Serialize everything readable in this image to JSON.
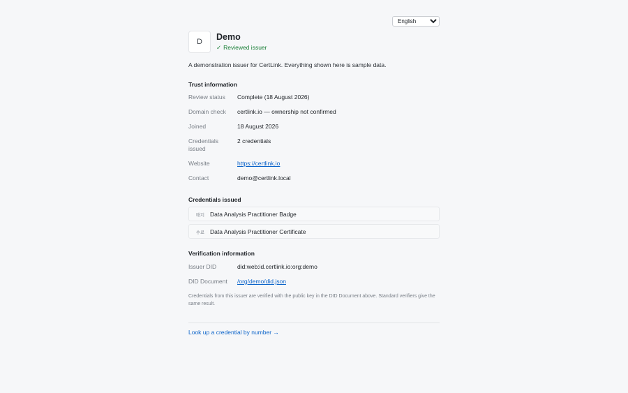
{
  "language": {
    "selected": "English",
    "options": [
      "English"
    ]
  },
  "issuer": {
    "avatar_letter": "D",
    "name": "Demo",
    "reviewed_check": "✓",
    "reviewed_label": "Reviewed issuer",
    "description": "A demonstration issuer for CertLink. Everything shown here is sample data."
  },
  "trust": {
    "title": "Trust information",
    "rows": [
      {
        "label": "Review status",
        "value": "Complete (18 August 2026)"
      },
      {
        "label": "Domain check",
        "value": "certlink.io — ownership not confirmed"
      },
      {
        "label": "Joined",
        "value": "18 August 2026"
      },
      {
        "label": "Credentials issued",
        "value": "2 credentials"
      },
      {
        "label": "Website",
        "value": "https://certlink.io"
      },
      {
        "label": "Contact",
        "value": "demo@certlink.local"
      }
    ]
  },
  "credentials": {
    "title": "Credentials issued",
    "items": [
      {
        "type": "배지",
        "name": "Data Analysis Practitioner Badge"
      },
      {
        "type": "수료",
        "name": "Data Analysis Practitioner Certificate"
      }
    ]
  },
  "verification": {
    "title": "Verification information",
    "rows": [
      {
        "label": "Issuer DID",
        "value": "did:web:id.certlink.io:org:demo"
      },
      {
        "label": "DID Document",
        "value": "/org/demo/did.json"
      }
    ],
    "note": "Credentials from this issuer are verified with the public key in the DID Document above. Standard verifiers give the same result."
  },
  "lookup_link": "Look up a credential by number →",
  "colors": {
    "background": "#f6f7f9",
    "reviewed_green": "#1a7f37",
    "link_blue": "#0b63c9",
    "muted_label": "#777d85"
  }
}
